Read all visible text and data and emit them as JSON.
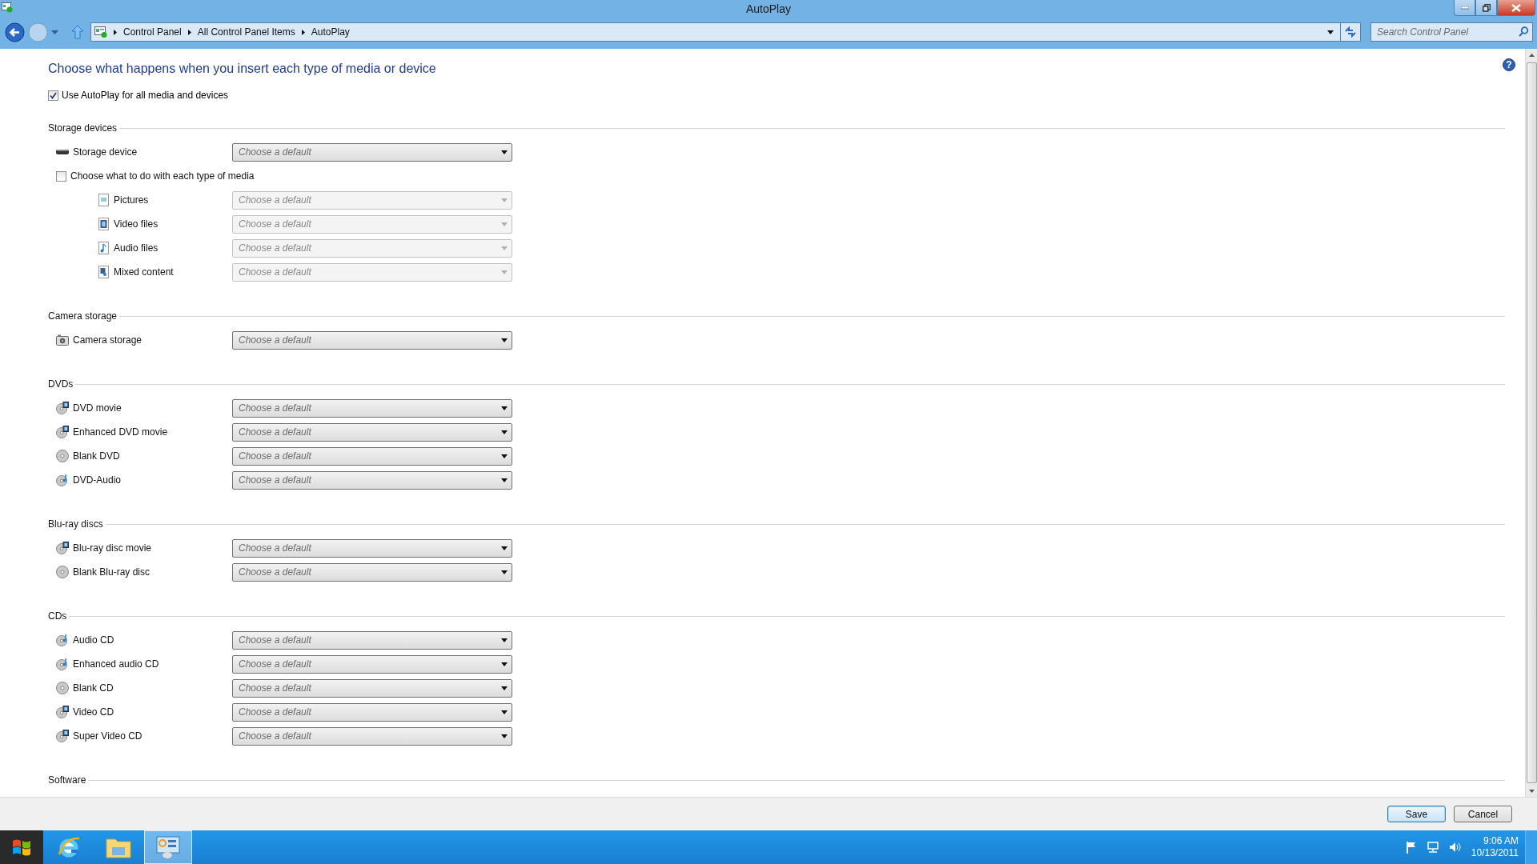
{
  "window": {
    "title": "AutoPlay"
  },
  "address_bar": {
    "breadcrumbs": [
      "Control Panel",
      "All Control Panel Items",
      "AutoPlay"
    ]
  },
  "search": {
    "placeholder": "Search Control Panel"
  },
  "help": {
    "glyph": "?"
  },
  "heading": "Choose what happens when you insert each type of media or device",
  "use_autoplay": {
    "label": "Use AutoPlay for all media and devices",
    "checked": true
  },
  "sections": [
    {
      "title": "Storage devices",
      "items": [
        {
          "kind": "drive",
          "label": "Storage device",
          "value": "Choose a default",
          "disabled": false
        },
        {
          "kind": "checkbox",
          "label": "Choose what to do with each type of media",
          "checked": false,
          "children": [
            {
              "kind": "picture-file",
              "label": "Pictures",
              "value": "Choose a default",
              "disabled": true
            },
            {
              "kind": "video-file",
              "label": "Video files",
              "value": "Choose a default",
              "disabled": true
            },
            {
              "kind": "audio-file",
              "label": "Audio files",
              "value": "Choose a default",
              "disabled": true
            },
            {
              "kind": "mixed-file",
              "label": "Mixed content",
              "value": "Choose a default",
              "disabled": true
            }
          ]
        }
      ]
    },
    {
      "title": "Camera storage",
      "items": [
        {
          "kind": "camera",
          "label": "Camera storage",
          "value": "Choose a default",
          "disabled": false
        }
      ]
    },
    {
      "title": "DVDs",
      "items": [
        {
          "kind": "disc-video",
          "label": "DVD movie",
          "value": "Choose a default",
          "disabled": false
        },
        {
          "kind": "disc-video",
          "label": "Enhanced DVD movie",
          "value": "Choose a default",
          "disabled": false
        },
        {
          "kind": "disc",
          "label": "Blank DVD",
          "value": "Choose a default",
          "disabled": false
        },
        {
          "kind": "disc-audio",
          "label": "DVD-Audio",
          "value": "Choose a default",
          "disabled": false
        }
      ]
    },
    {
      "title": "Blu-ray discs",
      "items": [
        {
          "kind": "disc-video",
          "label": "Blu-ray disc movie",
          "value": "Choose a default",
          "disabled": false
        },
        {
          "kind": "disc",
          "label": "Blank Blu-ray disc",
          "value": "Choose a default",
          "disabled": false
        }
      ]
    },
    {
      "title": "CDs",
      "items": [
        {
          "kind": "disc-audio",
          "label": "Audio CD",
          "value": "Choose a default",
          "disabled": false
        },
        {
          "kind": "disc-audio",
          "label": "Enhanced audio CD",
          "value": "Choose a default",
          "disabled": false
        },
        {
          "kind": "disc",
          "label": "Blank CD",
          "value": "Choose a default",
          "disabled": false
        },
        {
          "kind": "disc-video",
          "label": "Video CD",
          "value": "Choose a default",
          "disabled": false
        },
        {
          "kind": "disc-video",
          "label": "Super Video CD",
          "value": "Choose a default",
          "disabled": false
        }
      ]
    },
    {
      "title": "Software"
    }
  ],
  "buttons": [
    {
      "label": "Save",
      "default": true
    },
    {
      "label": "Cancel",
      "default": false
    }
  ],
  "taskbar": {
    "apps": [
      {
        "kind": "browser",
        "selected": false
      },
      {
        "kind": "folder",
        "selected": false
      },
      {
        "kind": "control-panel",
        "selected": true
      }
    ],
    "clock": {
      "time": "9:06 AM",
      "date": "10/13/2011"
    }
  }
}
